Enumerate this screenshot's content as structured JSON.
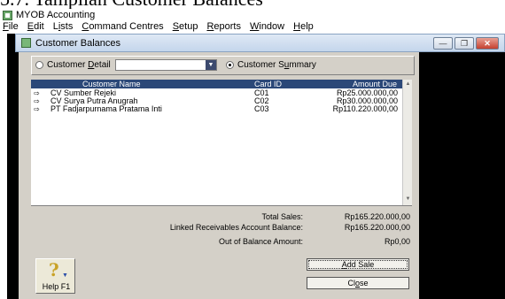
{
  "caption": "5.7. Tampilan Customer Balances",
  "app": {
    "title": "MYOB Accounting"
  },
  "menu": [
    {
      "pre": "",
      "ul": "F",
      "post": "ile"
    },
    {
      "pre": "",
      "ul": "E",
      "post": "dit"
    },
    {
      "pre": "L",
      "ul": "i",
      "post": "sts"
    },
    {
      "pre": "",
      "ul": "C",
      "post": "ommand Centres"
    },
    {
      "pre": "",
      "ul": "S",
      "post": "etup"
    },
    {
      "pre": "",
      "ul": "R",
      "post": "eports"
    },
    {
      "pre": "",
      "ul": "W",
      "post": "indow"
    },
    {
      "pre": "",
      "ul": "H",
      "post": "elp"
    }
  ],
  "window": {
    "title": "Customer Balances"
  },
  "filter": {
    "detail": {
      "pre": "Customer ",
      "ul": "D",
      "post": "etail",
      "selected": false
    },
    "summary": {
      "pre": "Customer S",
      "ul": "u",
      "post": "mmary",
      "selected": true
    },
    "combo_value": ""
  },
  "table": {
    "headers": {
      "name": "Customer Name",
      "card": "Card ID",
      "amount": "Amount Due"
    },
    "rows": [
      {
        "name": "CV Sumber Rejeki",
        "card": "C01",
        "amount": "Rp25.000.000,00"
      },
      {
        "name": "CV Surya Putra Anugrah",
        "card": "C02",
        "amount": "Rp30.000.000,00"
      },
      {
        "name": "PT Fadjarpurnama Pratama Inti",
        "card": "C03",
        "amount": "Rp110.220.000,00"
      }
    ]
  },
  "totals": {
    "total_sales_label": "Total Sales:",
    "total_sales_value": "Rp165.220.000,00",
    "linked_label": "Linked Receivables Account Balance:",
    "linked_value": "Rp165.220.000,00",
    "out_label": "Out of Balance Amount:",
    "out_value": "Rp0,00"
  },
  "buttons": {
    "help": "Help F1",
    "add_sale": {
      "pre": "",
      "ul": "A",
      "post": "dd Sale"
    },
    "close": {
      "pre": "Cl",
      "ul": "o",
      "post": "se"
    }
  },
  "colors": {
    "header_bg": "#2b4878",
    "panel_bg": "#d4d0c8",
    "mdi_bg": "#000000"
  }
}
